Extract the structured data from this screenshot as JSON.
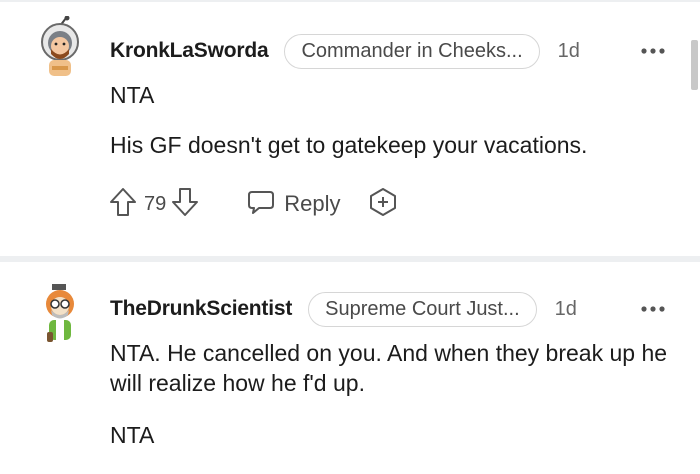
{
  "comments": [
    {
      "username": "KronkLaSworda",
      "flair": "Commander in Cheeks...",
      "time": "1d",
      "paragraphs": [
        "NTA",
        "His GF doesn't get to gatekeep your vacations."
      ],
      "votes": "79",
      "reply_label": "Reply"
    },
    {
      "username": "TheDrunkScientist",
      "flair": "Supreme Court Just...",
      "time": "1d",
      "paragraphs": [
        "NTA. He cancelled on you. And when they break up he will realize how he f'd up.",
        "NTA"
      ]
    }
  ],
  "icons": {
    "upvote": "upvote-arrow-icon",
    "downvote": "downvote-arrow-icon",
    "reply": "speech-bubble-icon",
    "award": "award-plus-icon",
    "more": "ellipsis-icon"
  },
  "colors": {
    "text": "#1c1c1c",
    "muted": "#4a4a4a",
    "separator": "#edeff1"
  }
}
